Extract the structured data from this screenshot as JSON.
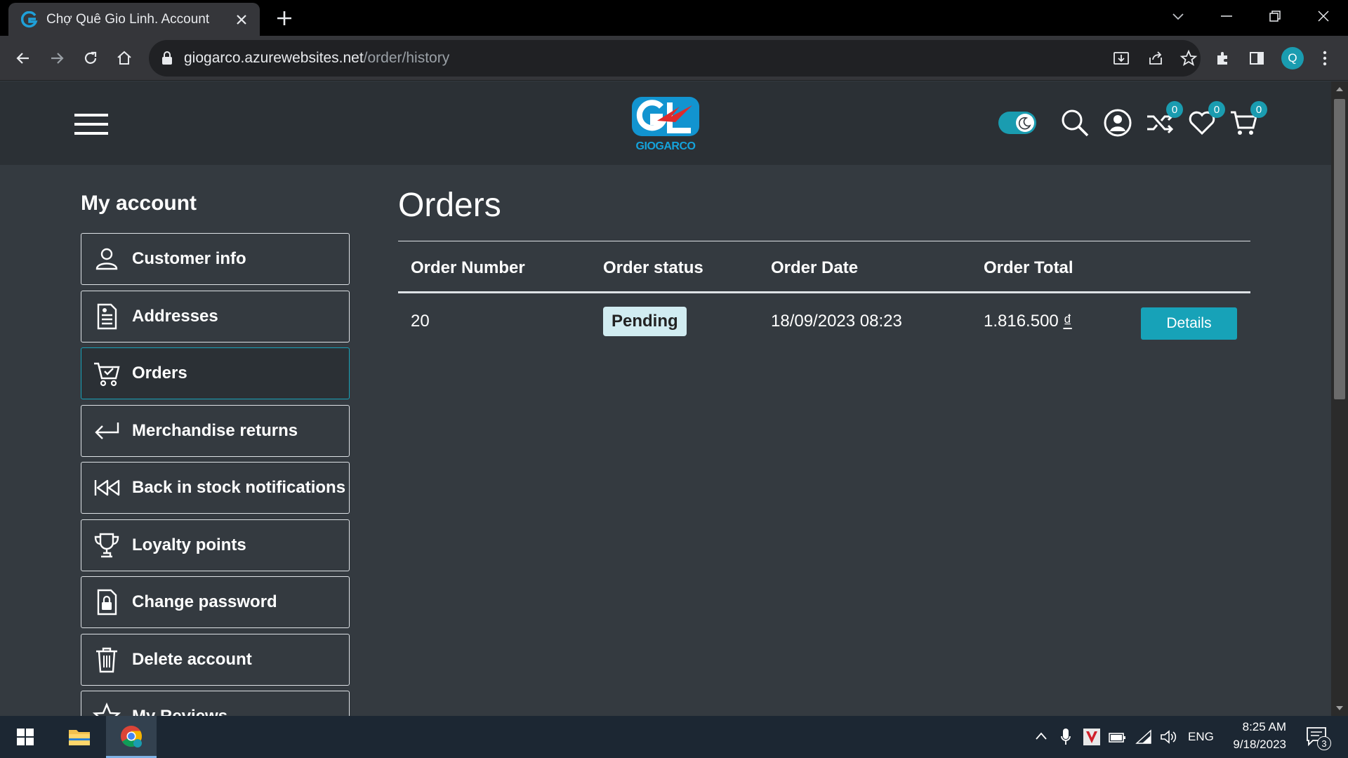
{
  "browser": {
    "tab_title": "Chợ Quê Gio Linh. Account",
    "url_host": "giogarco.azurewebsites.net",
    "url_path": "/order/history",
    "profile_initial": "Q"
  },
  "header": {
    "logo_text": "GIOGARCO",
    "compare_count": "0",
    "wishlist_count": "0",
    "cart_count": "0"
  },
  "sidebar": {
    "title": "My account",
    "items": [
      {
        "label": "Customer info",
        "icon": "user-icon"
      },
      {
        "label": "Addresses",
        "icon": "address-book-icon"
      },
      {
        "label": "Orders",
        "icon": "cart-icon"
      },
      {
        "label": "Merchandise returns",
        "icon": "return-arrow-icon"
      },
      {
        "label": "Back in stock notifications",
        "icon": "rewind-icon"
      },
      {
        "label": "Loyalty points",
        "icon": "trophy-icon"
      },
      {
        "label": "Change password",
        "icon": "lock-icon"
      },
      {
        "label": "Delete account",
        "icon": "trash-icon"
      },
      {
        "label": "My Reviews",
        "icon": "star-icon"
      }
    ]
  },
  "main": {
    "title": "Orders",
    "columns": [
      "Order Number",
      "Order status",
      "Order Date",
      "Order Total"
    ],
    "orders": [
      {
        "number": "20",
        "status": "Pending",
        "date": "18/09/2023 08:23",
        "total": "1.816.500",
        "currency": "₫",
        "action": "Details"
      }
    ]
  },
  "taskbar": {
    "language": "ENG",
    "time": "8:25 AM",
    "date": "9/18/2023",
    "notifications": "3"
  },
  "colors": {
    "accent": "#17a2b8",
    "page_bg": "#343a40",
    "header_bg": "#2b3035",
    "badge_bg": "#d1ecf1"
  }
}
